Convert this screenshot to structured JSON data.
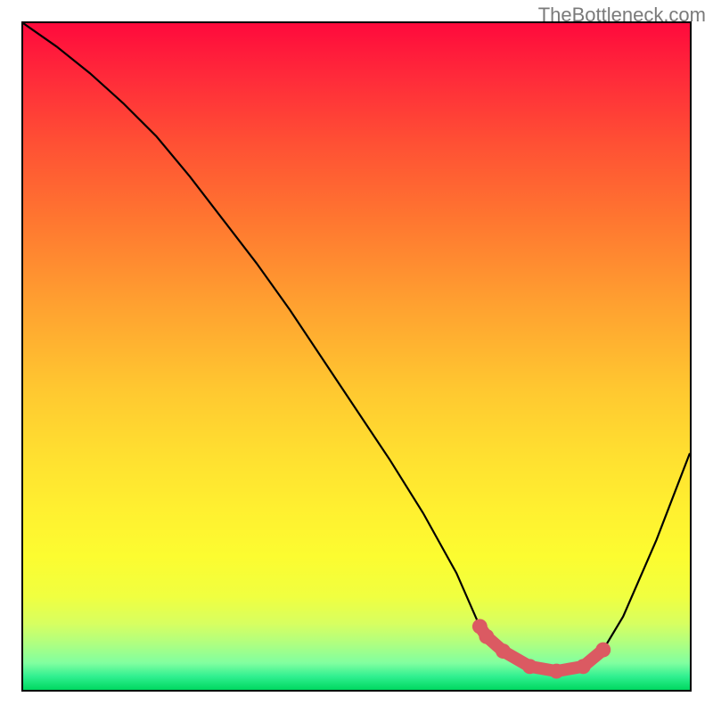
{
  "watermark": "TheBottleneck.com",
  "chart_data": {
    "type": "line",
    "title": "",
    "xlabel": "",
    "ylabel": "",
    "xlim": [
      0,
      1
    ],
    "ylim": [
      0,
      1
    ],
    "series": [
      {
        "name": "bottleneck-curve",
        "x": [
          0.0,
          0.05,
          0.1,
          0.15,
          0.2,
          0.25,
          0.3,
          0.35,
          0.4,
          0.45,
          0.5,
          0.55,
          0.6,
          0.65,
          0.685,
          0.72,
          0.76,
          0.8,
          0.84,
          0.87,
          0.9,
          0.95,
          1.0
        ],
        "values": [
          1.0,
          0.965,
          0.925,
          0.88,
          0.83,
          0.77,
          0.705,
          0.64,
          0.57,
          0.495,
          0.42,
          0.345,
          0.265,
          0.175,
          0.095,
          0.058,
          0.035,
          0.028,
          0.035,
          0.06,
          0.11,
          0.225,
          0.355
        ]
      },
      {
        "name": "highlight-dots",
        "x": [
          0.685,
          0.695,
          0.72,
          0.76,
          0.8,
          0.84,
          0.87
        ],
        "values": [
          0.095,
          0.08,
          0.058,
          0.035,
          0.028,
          0.035,
          0.06
        ]
      }
    ],
    "colors": {
      "curve": "#000000",
      "dots": "#db5a62"
    }
  }
}
